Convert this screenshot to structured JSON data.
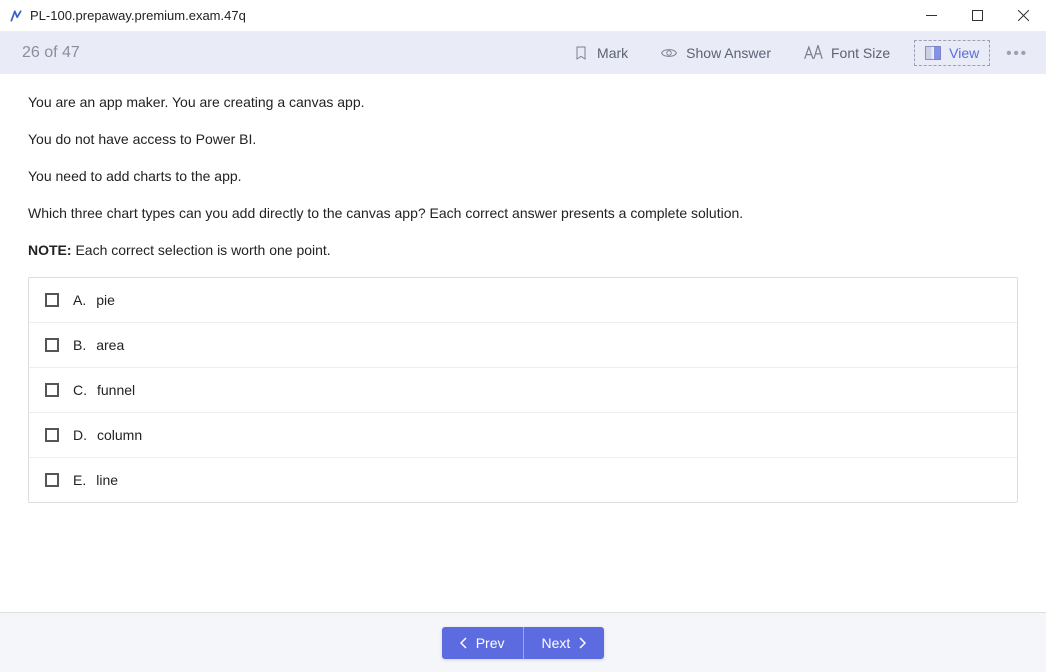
{
  "title": "PL-100.prepaway.premium.exam.47q",
  "counter": "26 of 47",
  "toolbar": {
    "mark": "Mark",
    "show_answer": "Show Answer",
    "font_size": "Font Size",
    "view": "View"
  },
  "question": {
    "paragraphs": [
      "You are an app maker. You are creating a canvas app.",
      "You do not have access to Power BI.",
      "You need to add charts to the app.",
      "Which three chart types can you add directly to the canvas app? Each correct answer presents a complete solution."
    ],
    "note_label": "NOTE:",
    "note_text": " Each correct selection is worth one point."
  },
  "options": [
    {
      "letter": "A.",
      "text": "pie"
    },
    {
      "letter": "B.",
      "text": "area"
    },
    {
      "letter": "C.",
      "text": "funnel"
    },
    {
      "letter": "D.",
      "text": "column"
    },
    {
      "letter": "E.",
      "text": "line"
    }
  ],
  "nav": {
    "prev": "Prev",
    "next": "Next"
  }
}
